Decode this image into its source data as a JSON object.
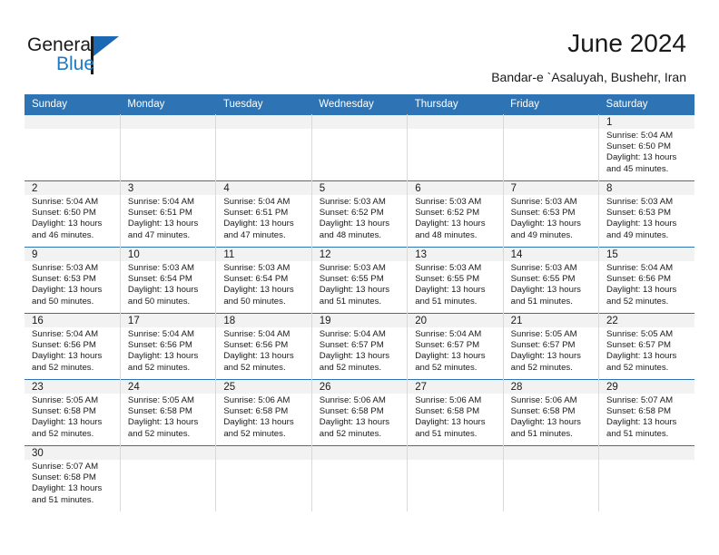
{
  "brand": {
    "logo_top": "General",
    "logo_bottom": "Blue",
    "logo_icon": "triangle-flag-icon",
    "colors": {
      "accent": "#2e74b5",
      "logo_blue": "#1f7ac1",
      "band": "#f2f2f2"
    }
  },
  "header": {
    "title": "June 2024",
    "subtitle": "Bandar-e `Asaluyah, Bushehr, Iran"
  },
  "calendar": {
    "weekday_headers": [
      "Sunday",
      "Monday",
      "Tuesday",
      "Wednesday",
      "Thursday",
      "Friday",
      "Saturday"
    ],
    "weeks": [
      [
        {
          "day": "",
          "blank": true
        },
        {
          "day": "",
          "blank": true
        },
        {
          "day": "",
          "blank": true
        },
        {
          "day": "",
          "blank": true
        },
        {
          "day": "",
          "blank": true
        },
        {
          "day": "",
          "blank": true
        },
        {
          "day": "1",
          "sunrise": "Sunrise: 5:04 AM",
          "sunset": "Sunset: 6:50 PM",
          "daylight": "Daylight: 13 hours and 45 minutes."
        }
      ],
      [
        {
          "day": "2",
          "sunrise": "Sunrise: 5:04 AM",
          "sunset": "Sunset: 6:50 PM",
          "daylight": "Daylight: 13 hours and 46 minutes."
        },
        {
          "day": "3",
          "sunrise": "Sunrise: 5:04 AM",
          "sunset": "Sunset: 6:51 PM",
          "daylight": "Daylight: 13 hours and 47 minutes."
        },
        {
          "day": "4",
          "sunrise": "Sunrise: 5:04 AM",
          "sunset": "Sunset: 6:51 PM",
          "daylight": "Daylight: 13 hours and 47 minutes."
        },
        {
          "day": "5",
          "sunrise": "Sunrise: 5:03 AM",
          "sunset": "Sunset: 6:52 PM",
          "daylight": "Daylight: 13 hours and 48 minutes."
        },
        {
          "day": "6",
          "sunrise": "Sunrise: 5:03 AM",
          "sunset": "Sunset: 6:52 PM",
          "daylight": "Daylight: 13 hours and 48 minutes."
        },
        {
          "day": "7",
          "sunrise": "Sunrise: 5:03 AM",
          "sunset": "Sunset: 6:53 PM",
          "daylight": "Daylight: 13 hours and 49 minutes."
        },
        {
          "day": "8",
          "sunrise": "Sunrise: 5:03 AM",
          "sunset": "Sunset: 6:53 PM",
          "daylight": "Daylight: 13 hours and 49 minutes."
        }
      ],
      [
        {
          "day": "9",
          "sunrise": "Sunrise: 5:03 AM",
          "sunset": "Sunset: 6:53 PM",
          "daylight": "Daylight: 13 hours and 50 minutes."
        },
        {
          "day": "10",
          "sunrise": "Sunrise: 5:03 AM",
          "sunset": "Sunset: 6:54 PM",
          "daylight": "Daylight: 13 hours and 50 minutes."
        },
        {
          "day": "11",
          "sunrise": "Sunrise: 5:03 AM",
          "sunset": "Sunset: 6:54 PM",
          "daylight": "Daylight: 13 hours and 50 minutes."
        },
        {
          "day": "12",
          "sunrise": "Sunrise: 5:03 AM",
          "sunset": "Sunset: 6:55 PM",
          "daylight": "Daylight: 13 hours and 51 minutes."
        },
        {
          "day": "13",
          "sunrise": "Sunrise: 5:03 AM",
          "sunset": "Sunset: 6:55 PM",
          "daylight": "Daylight: 13 hours and 51 minutes."
        },
        {
          "day": "14",
          "sunrise": "Sunrise: 5:03 AM",
          "sunset": "Sunset: 6:55 PM",
          "daylight": "Daylight: 13 hours and 51 minutes."
        },
        {
          "day": "15",
          "sunrise": "Sunrise: 5:04 AM",
          "sunset": "Sunset: 6:56 PM",
          "daylight": "Daylight: 13 hours and 52 minutes."
        }
      ],
      [
        {
          "day": "16",
          "sunrise": "Sunrise: 5:04 AM",
          "sunset": "Sunset: 6:56 PM",
          "daylight": "Daylight: 13 hours and 52 minutes."
        },
        {
          "day": "17",
          "sunrise": "Sunrise: 5:04 AM",
          "sunset": "Sunset: 6:56 PM",
          "daylight": "Daylight: 13 hours and 52 minutes."
        },
        {
          "day": "18",
          "sunrise": "Sunrise: 5:04 AM",
          "sunset": "Sunset: 6:56 PM",
          "daylight": "Daylight: 13 hours and 52 minutes."
        },
        {
          "day": "19",
          "sunrise": "Sunrise: 5:04 AM",
          "sunset": "Sunset: 6:57 PM",
          "daylight": "Daylight: 13 hours and 52 minutes."
        },
        {
          "day": "20",
          "sunrise": "Sunrise: 5:04 AM",
          "sunset": "Sunset: 6:57 PM",
          "daylight": "Daylight: 13 hours and 52 minutes."
        },
        {
          "day": "21",
          "sunrise": "Sunrise: 5:05 AM",
          "sunset": "Sunset: 6:57 PM",
          "daylight": "Daylight: 13 hours and 52 minutes."
        },
        {
          "day": "22",
          "sunrise": "Sunrise: 5:05 AM",
          "sunset": "Sunset: 6:57 PM",
          "daylight": "Daylight: 13 hours and 52 minutes."
        }
      ],
      [
        {
          "day": "23",
          "sunrise": "Sunrise: 5:05 AM",
          "sunset": "Sunset: 6:58 PM",
          "daylight": "Daylight: 13 hours and 52 minutes."
        },
        {
          "day": "24",
          "sunrise": "Sunrise: 5:05 AM",
          "sunset": "Sunset: 6:58 PM",
          "daylight": "Daylight: 13 hours and 52 minutes."
        },
        {
          "day": "25",
          "sunrise": "Sunrise: 5:06 AM",
          "sunset": "Sunset: 6:58 PM",
          "daylight": "Daylight: 13 hours and 52 minutes."
        },
        {
          "day": "26",
          "sunrise": "Sunrise: 5:06 AM",
          "sunset": "Sunset: 6:58 PM",
          "daylight": "Daylight: 13 hours and 52 minutes."
        },
        {
          "day": "27",
          "sunrise": "Sunrise: 5:06 AM",
          "sunset": "Sunset: 6:58 PM",
          "daylight": "Daylight: 13 hours and 51 minutes."
        },
        {
          "day": "28",
          "sunrise": "Sunrise: 5:06 AM",
          "sunset": "Sunset: 6:58 PM",
          "daylight": "Daylight: 13 hours and 51 minutes."
        },
        {
          "day": "29",
          "sunrise": "Sunrise: 5:07 AM",
          "sunset": "Sunset: 6:58 PM",
          "daylight": "Daylight: 13 hours and 51 minutes."
        }
      ],
      [
        {
          "day": "30",
          "sunrise": "Sunrise: 5:07 AM",
          "sunset": "Sunset: 6:58 PM",
          "daylight": "Daylight: 13 hours and 51 minutes."
        },
        {
          "day": "",
          "blank": true
        },
        {
          "day": "",
          "blank": true
        },
        {
          "day": "",
          "blank": true
        },
        {
          "day": "",
          "blank": true
        },
        {
          "day": "",
          "blank": true
        },
        {
          "day": "",
          "blank": true
        }
      ]
    ]
  }
}
